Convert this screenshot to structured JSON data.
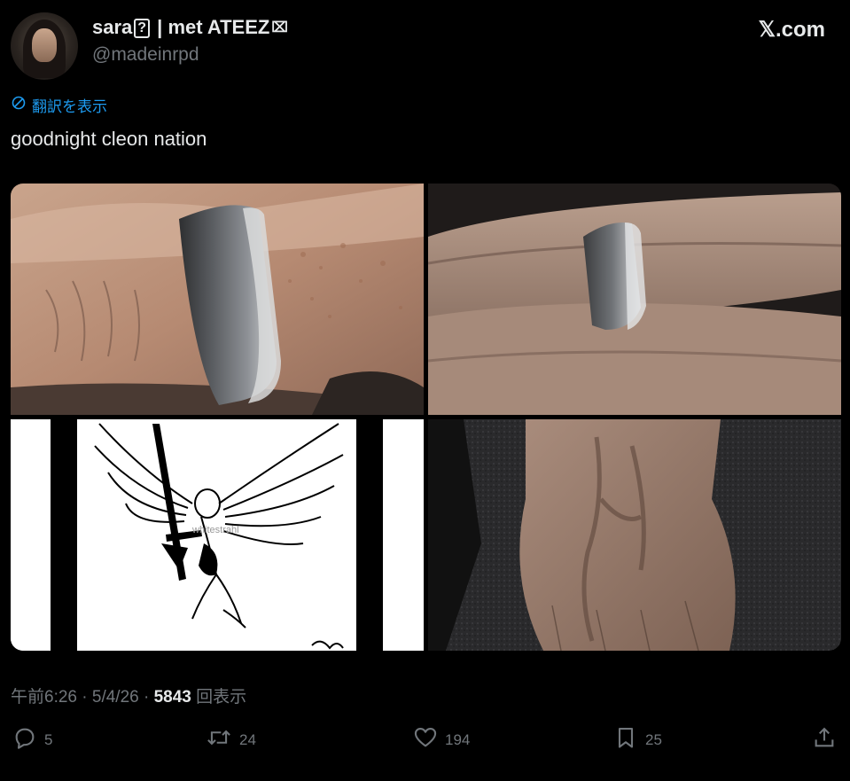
{
  "header": {
    "display_name_prefix": "sara",
    "display_name_box": "?",
    "display_name_suffix": " | met ATEEZ",
    "flag_glyph": "⌧",
    "handle": "@madeinrpd",
    "brand": "𝕏.com",
    "avatar_icon": "profile-avatar"
  },
  "translate": {
    "icon": "globe-icon",
    "label": "翻訳を表示"
  },
  "tweet": {
    "text": "goodnight cleon nation"
  },
  "media": {
    "images": [
      {
        "name": "ring-closeup-finger"
      },
      {
        "name": "ring-on-hand"
      },
      {
        "name": "winged-angel-illustration",
        "watermark": "whitestrahl"
      },
      {
        "name": "hand-veins-wrist"
      }
    ]
  },
  "meta": {
    "time": "午前6:26",
    "sep1": " · ",
    "date": "5/4/26",
    "sep2": " · ",
    "views": "5843",
    "views_label": " 回表示"
  },
  "actions": {
    "reply": {
      "icon": "reply-icon",
      "count": "5"
    },
    "repost": {
      "icon": "repost-icon",
      "count": "24"
    },
    "like": {
      "icon": "heart-icon",
      "count": "194"
    },
    "bookmark": {
      "icon": "bookmark-icon",
      "count": "25"
    },
    "share": {
      "icon": "share-icon"
    }
  },
  "colors": {
    "background": "#000000",
    "text": "#e7e9ea",
    "muted": "#71767b",
    "link": "#1d9bf0"
  }
}
